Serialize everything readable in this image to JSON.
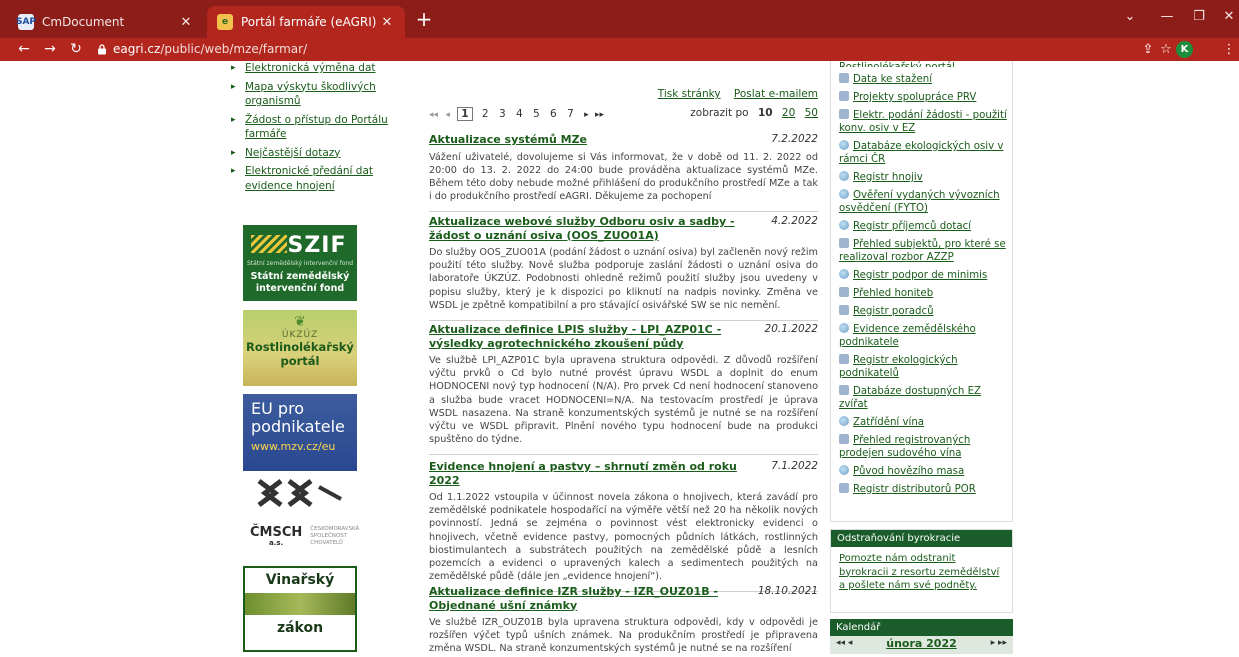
{
  "browser": {
    "tabs": [
      {
        "title": "CmDocument",
        "active": false,
        "favicon": "sap-favicon"
      },
      {
        "title": "Portál farmáře (eAGRI)",
        "active": true,
        "favicon": "eagri-favicon"
      }
    ],
    "address": {
      "host": "eagri.cz",
      "path": "/public/web/mze/farmar/"
    },
    "profile_initial": "K",
    "colors": {
      "frame": "#8c1d18",
      "toolbar": "#b3261e",
      "avatar": "#1e8e3e"
    }
  },
  "left_nav": {
    "items": [
      "Elektronická výměna dat",
      "Mapa výskytu škodlivých organismů",
      "Žádost o přístup do Portálu farmáře",
      "Nejčastější dotazy",
      "Elektronické předání dat evidence hnojení"
    ]
  },
  "banners": {
    "szif": {
      "logo": "SZIF",
      "small": "Státní zemědělský intervenční fond",
      "name": "Státní zemědělský intervenční fond"
    },
    "ukzuz": {
      "abbr": "ÚKZÚZ",
      "name": "Rostlinolékařský portál"
    },
    "eu": {
      "line1": "EU pro",
      "line2": "podnikatele",
      "url": "www.mzv.cz/eu"
    },
    "cmsch": {
      "abbr": "ČMSCH",
      "suffix": "a.s.",
      "full": "ČESKOMORAVSKÁ SPOLEČNOST CHOVATELŮ"
    },
    "vinarsky": {
      "line1": "Vinařský",
      "line2": "zákon"
    }
  },
  "page_tools": {
    "print": "Tisk stránky",
    "email": "Poslat e-mailem"
  },
  "pager": {
    "first": "◂◂",
    "prev": "◂",
    "pages": [
      "1",
      "2",
      "3",
      "4",
      "5",
      "6",
      "7"
    ],
    "current": "1",
    "next": "▸",
    "last": "▸▸",
    "per_page_label": "zobrazit po",
    "per_page_options": [
      "10",
      "20",
      "50"
    ],
    "per_page_selected": "10"
  },
  "articles": [
    {
      "title": "Aktualizace systémů MZe",
      "date": "7.2.2022",
      "body": "Vážení uživatelé, dovolujeme si Vás informovat, že v době od 11. 2. 2022 od 20:00 do 13. 2. 2022 do 24:00 bude prováděna aktualizace systémů MZe. Během této doby nebude možné přihlášení do produkčního prostředí MZe a tak i do produkčního prostředí eAGRI. Děkujeme za pochopení"
    },
    {
      "title": "Aktualizace webové služby Odboru osiv a sadby - žádost o uznání osiva (OOS_ZUO01A)",
      "date": "4.2.2022",
      "body": "Do služby OOS_ZUO01A (podání žádost o uznání osiva) byl začleněn nový režim použití této služby. Nově služba podporuje zaslání žádosti o uznání osiva do laboratoře ÚKZÚZ. Podobnosti ohledně režimů použití služby jsou uvedeny v popisu služby, který je k dispozici po kliknutí na nadpis novinky. Změna ve WSDL je zpětně kompatibilní a pro stávající osivářské SW se nic nemění."
    },
    {
      "title": "Aktualizace definice LPIS služby - LPI_AZP01C - výsledky agrotechnického zkoušení půdy",
      "date": "20.1.2022",
      "body": "Ve službě LPI_AZP01C byla upravena struktura odpovědi. Z důvodů rozšíření výčtu prvků o Cd bylo nutné provést úpravu WSDL a doplnit do enum HODNOCENI nový typ hodnocení (N/A). Pro prvek Cd není hodnocení stanoveno a služba bude vracet HODNOCENI=N/A. Na testovacím prostředí je úprava WSDL nasazena. Na straně konzumentských systémů je nutné se na rozšíření výčtu ve WSDL připravit. Plnění nového typu hodnocení bude na produkci spuštěno do týdne."
    },
    {
      "title": "Evidence hnojení a pastvy – shrnutí změn od roku 2022",
      "date": "7.1.2022",
      "body": "Od 1.1.2022 vstoupila v účinnost novela zákona o hnojivech, která zavádí pro zemědělské podnikatele hospodařící na výměře větší než 20 ha několik nových povinností. Jedná se zejména o povinnost vést elektronicky evidenci o hnojivech, včetně evidence pastvy, pomocných půdních látkách, rostlinných biostimulantech a substrátech použitých na zemědělské půdě a lesních pozemcích a evidenci o upravených kalech a sedimentech použitých na zemědělské půdě (dále jen „evidence hnojení“)."
    },
    {
      "title": "Aktualizace definice IZR služby - IZR_OUZ01B - Objednané ušní známky",
      "date": "18.10.2021",
      "body": "Ve službě IZR_OUZ01B byla upravena struktura odpovědi, kdy v odpovědi je rozšířen výčet typů ušních známek. Na produkčním prostředí je připravena změna WSDL. Na straně konzumentských systémů je nutné se na rozšíření"
    }
  ],
  "right_links": [
    {
      "label": "Data ke stažení",
      "icon": "doc"
    },
    {
      "label": "Projekty spolupráce PRV",
      "icon": "doc"
    },
    {
      "label": "Elektr. podání žádosti - použití konv. osiv v EZ",
      "icon": "doc"
    },
    {
      "label": "Databáze ekologických osiv v rámci ČR",
      "icon": "globe"
    },
    {
      "label": "Registr hnojiv",
      "icon": "globe"
    },
    {
      "label": "Ověření vydaných vývozních osvědčení (FYTO)",
      "icon": "globe"
    },
    {
      "label": "Registr příjemců dotací",
      "icon": "globe"
    },
    {
      "label": "Přehled subjektů, pro které se realizoval rozbor AZZP",
      "icon": "doc"
    },
    {
      "label": "Registr podpor de minimis",
      "icon": "globe"
    },
    {
      "label": "Přehled honiteb",
      "icon": "doc"
    },
    {
      "label": "Registr poradců",
      "icon": "doc"
    },
    {
      "label": "Evidence zemědělského podnikatele",
      "icon": "globe"
    },
    {
      "label": "Registr ekologických podnikatelů",
      "icon": "doc"
    },
    {
      "label": "Databáze dostupných EZ zvířat",
      "icon": "doc"
    },
    {
      "label": "Zatřídění vína",
      "icon": "globe"
    },
    {
      "label": "Přehled registrovaných prodejen sudového vína",
      "icon": "doc"
    },
    {
      "label": "Původ hovězího masa",
      "icon": "globe"
    },
    {
      "label": "Registr distributorů POR",
      "icon": "doc"
    }
  ],
  "byrokracie": {
    "header": "Odstraňování byrokracie",
    "text": "Pomozte nám odstranit byrokracii z resortu zemědělství a pošlete nám své podněty."
  },
  "calendar": {
    "header": "Kalendář",
    "month": "února 2022",
    "prev": "◂◂ ◂",
    "next": "▸ ▸▸"
  }
}
